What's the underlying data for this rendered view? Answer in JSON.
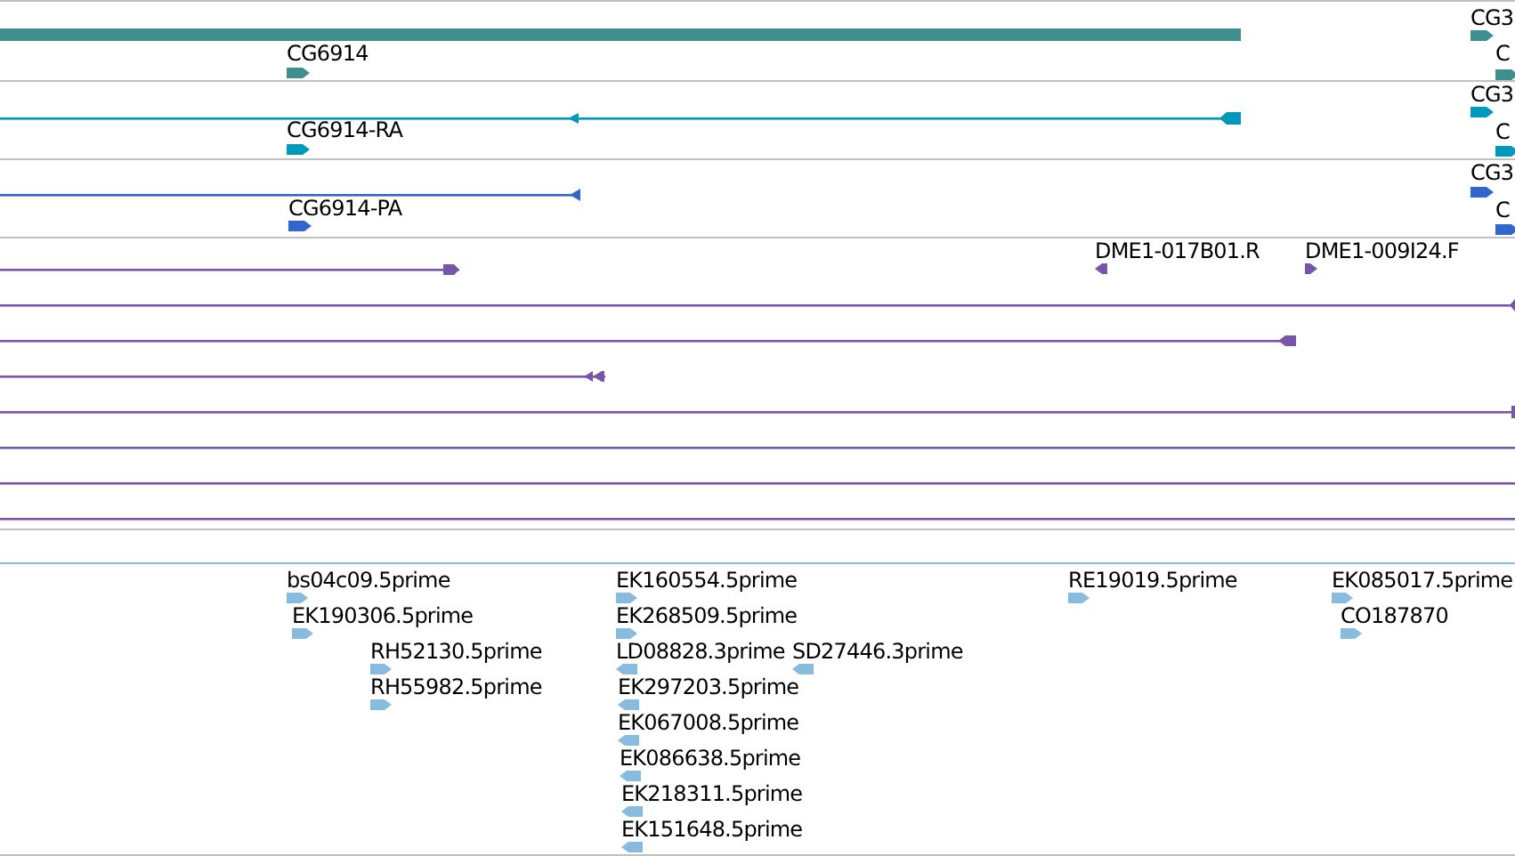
{
  "tracks": [
    {
      "kind": "gene",
      "features": [
        {
          "label": "CG6914",
          "kind": "forward"
        },
        {
          "label": "CG3",
          "kind": "forward"
        },
        {
          "label": "C",
          "kind": "forward"
        }
      ]
    },
    {
      "kind": "mrna",
      "features": [
        {
          "label": "CG6914-RA",
          "kind": "forward"
        },
        {
          "label": "CG3",
          "kind": "forward"
        },
        {
          "label": "C",
          "kind": "forward"
        }
      ]
    },
    {
      "kind": "protein",
      "features": [
        {
          "label": "CG6914-PA",
          "kind": "forward"
        },
        {
          "label": "CG3",
          "kind": "forward"
        },
        {
          "label": "C",
          "kind": "forward"
        }
      ]
    },
    {
      "kind": "clone",
      "features": [
        {
          "label": "DME1-017B01.R",
          "kind": "reverse"
        },
        {
          "label": "DME1-009I24.F",
          "kind": "forward"
        }
      ]
    },
    {
      "kind": "est",
      "features": [
        {
          "label": "bs04c09.5prime",
          "kind": "forward"
        },
        {
          "label": "EK190306.5prime",
          "kind": "forward"
        },
        {
          "label": "RH52130.5prime",
          "kind": "forward"
        },
        {
          "label": "RH55982.5prime",
          "kind": "forward"
        },
        {
          "label": "EK160554.5prime",
          "kind": "forward"
        },
        {
          "label": "EK268509.5prime",
          "kind": "forward"
        },
        {
          "label": "LD08828.3prime",
          "kind": "reverse"
        },
        {
          "label": "SD27446.3prime",
          "kind": "reverse"
        },
        {
          "label": "EK297203.5prime",
          "kind": "reverse"
        },
        {
          "label": "EK067008.5prime",
          "kind": "reverse"
        },
        {
          "label": "EK086638.5prime",
          "kind": "reverse"
        },
        {
          "label": "EK218311.5prime",
          "kind": "reverse"
        },
        {
          "label": "EK151648.5prime",
          "kind": "reverse"
        },
        {
          "label": "RE19019.5prime",
          "kind": "forward"
        },
        {
          "label": "EK085017.5prime",
          "kind": "forward"
        },
        {
          "label": "CO187870",
          "kind": "forward"
        }
      ]
    }
  ]
}
